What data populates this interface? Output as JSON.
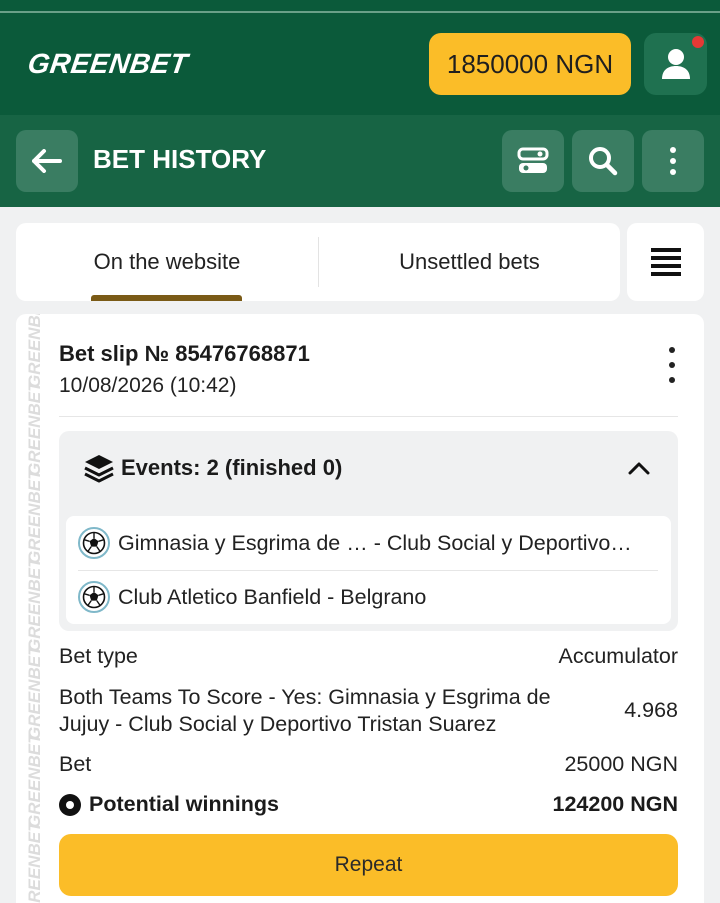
{
  "app": {
    "logo": "GREENBET",
    "balance": "1850000 NGN"
  },
  "header": {
    "title": "BET HISTORY"
  },
  "tabs": [
    {
      "label": "On the website",
      "active": true
    },
    {
      "label": "Unsettled bets",
      "active": false
    }
  ],
  "colors": {
    "brand": "#0b5a3a",
    "header": "#176444",
    "accent": "#fbbd28",
    "tab_indicator": "#7a5a16"
  },
  "bet": {
    "slip_title": "Bet slip № 85476768871",
    "date": "10/08/2026 (10:42)",
    "events_label": "Events: 2 (finished 0)",
    "events": [
      {
        "name": "Gimnasia y Esgrima de … - Club Social y Deportivo…",
        "icon": "soccer-ball-icon"
      },
      {
        "name": "Club Atletico Banfield - Belgrano",
        "icon": "soccer-ball-icon"
      }
    ],
    "bet_type_label": "Bet type",
    "bet_type_value": "Accumulator",
    "pick": "Both Teams To Score - Yes: Gimnasia y Esgrima de Jujuy - Club Social y Deportivo Tristan Suarez",
    "odds": "4.968",
    "bet_label": "Bet",
    "bet_value": "25000 NGN",
    "winnings_label": "Potential winnings",
    "winnings_value": "124200 NGN",
    "repeat_label": "Repeat"
  }
}
